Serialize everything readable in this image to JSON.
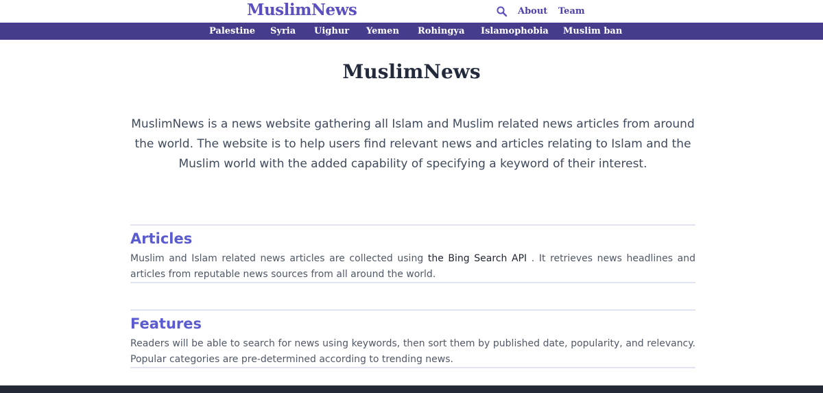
{
  "header": {
    "brand": "MuslimNews",
    "links": {
      "about": "About",
      "team": "Team"
    },
    "search_icon": "search-icon"
  },
  "nav": {
    "items": [
      "Palestine",
      "Syria",
      "Uighur",
      "Yemen",
      "Rohingya",
      "Islamophobia",
      "Muslim ban"
    ]
  },
  "hero": {
    "title": "MuslimNews",
    "description": "MuslimNews is a news website gathering all Islam and Muslim related news articles from around the world. The website is to help users find relevant news and articles relating to Islam and the Muslim world with the added capability of specifying a keyword of their interest."
  },
  "sections": {
    "articles": {
      "title": "Articles",
      "body_before": "Muslim and Islam related news articles are collected using ",
      "link": "the Bing Search API",
      "body_after": " . It retrieves news headlines and articles from reputable news sources from all around the world."
    },
    "features": {
      "title": "Features",
      "body": "Readers will be able to search for news using keywords, then sort them by published date, popularity, and relevancy. Popular categories are pre-determined according to trending news."
    }
  },
  "colors": {
    "brand": "#5b4fbf",
    "nav_bg": "#453d8c",
    "section_title": "#5a5bd0",
    "footer_bg": "#232a35"
  }
}
